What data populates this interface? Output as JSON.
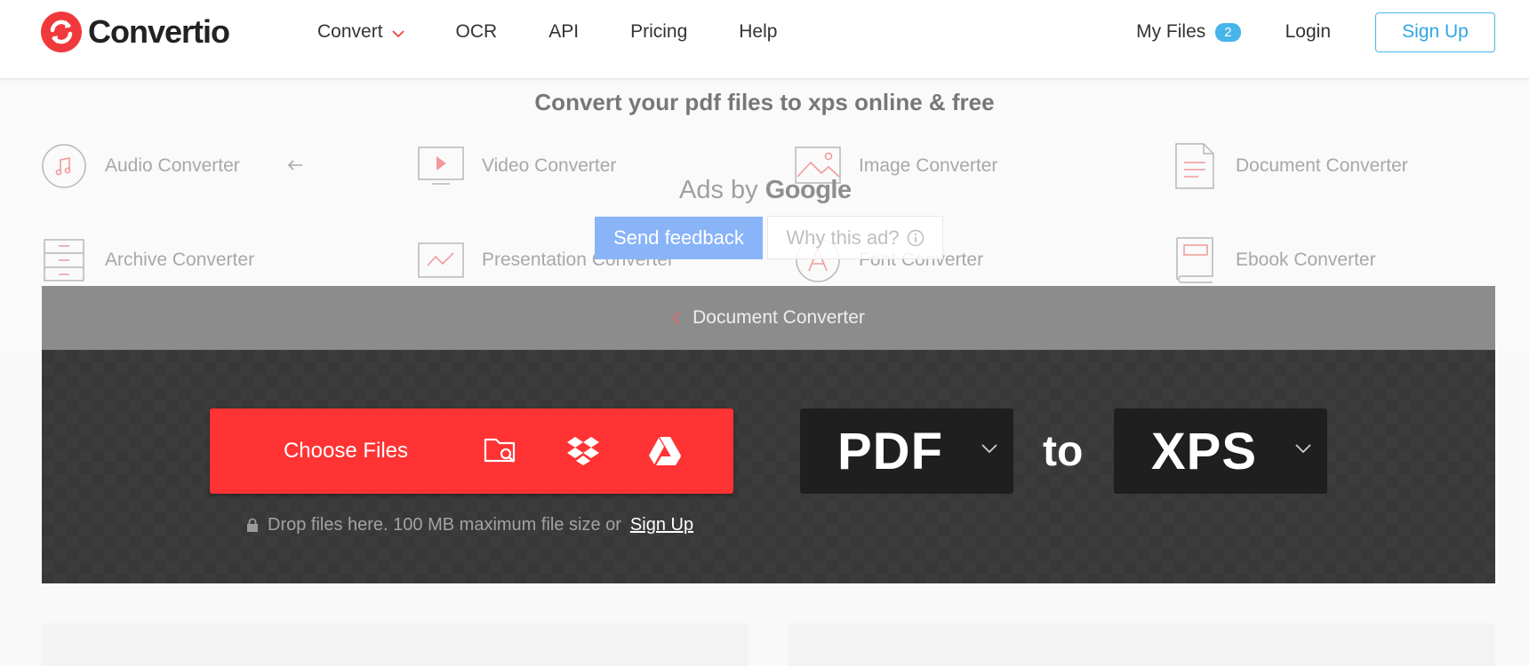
{
  "brand": {
    "name": "Convertio",
    "accent": "#ff3333",
    "link": "#47b4ea"
  },
  "nav": {
    "items": [
      {
        "label": "Convert",
        "has_dropdown": true
      },
      {
        "label": "OCR"
      },
      {
        "label": "API"
      },
      {
        "label": "Pricing"
      },
      {
        "label": "Help"
      }
    ],
    "my_files": "My Files",
    "my_files_count": "2",
    "login": "Login",
    "signup": "Sign Up"
  },
  "heading": "Convert your pdf files to xps online & free",
  "categories": [
    {
      "label": "Audio Converter",
      "icon": "music-note-icon"
    },
    {
      "label": "Video Converter",
      "icon": "video-play-icon"
    },
    {
      "label": "Image Converter",
      "icon": "image-icon"
    },
    {
      "label": "Document Converter",
      "icon": "document-icon"
    },
    {
      "label": "Archive Converter",
      "icon": "archive-icon"
    },
    {
      "label": "Presentation Converter",
      "icon": "presentation-icon"
    },
    {
      "label": "Font Converter",
      "icon": "font-icon"
    },
    {
      "label": "Ebook Converter",
      "icon": "ebook-icon"
    }
  ],
  "ad": {
    "ads_by": "Ads by",
    "google": "Google",
    "send_feedback": "Send feedback",
    "why_this_ad": "Why this ad?"
  },
  "breadcrumb": "Document Converter",
  "uploader": {
    "choose_files": "Choose Files",
    "sources": [
      "folder-search-icon",
      "dropbox-icon",
      "google-drive-icon"
    ],
    "from_format": "PDF",
    "to_word": "to",
    "to_format": "XPS",
    "hint": "Drop files here. 100 MB maximum file size or",
    "hint_link": "Sign Up"
  }
}
